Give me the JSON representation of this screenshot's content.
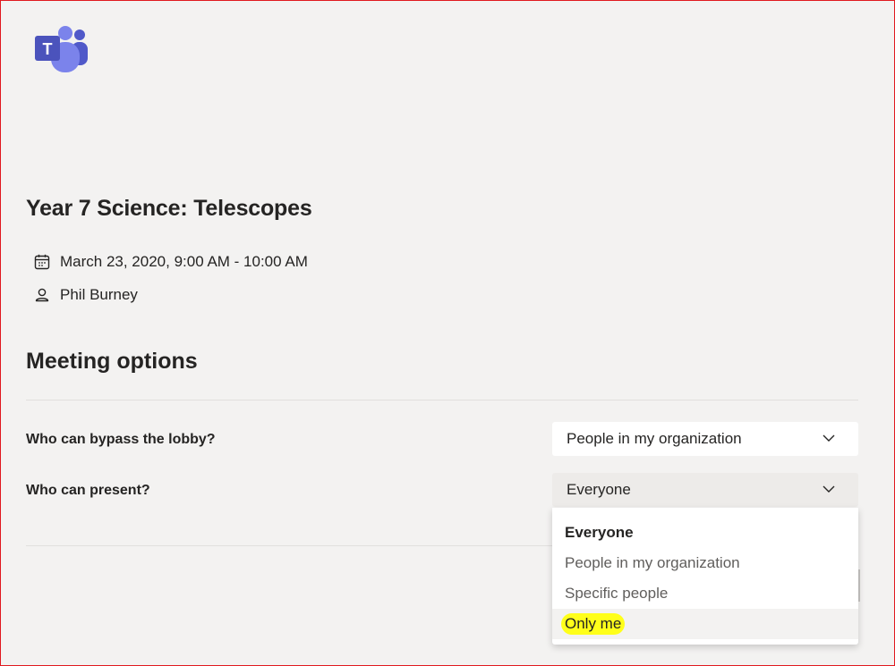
{
  "app": {
    "logo": "microsoft-teams-logo",
    "accent": "#5b5fc7"
  },
  "meeting": {
    "title": "Year 7 Science: Telescopes",
    "datetime": "March 23, 2020, 9:00 AM - 10:00 AM",
    "organizer": "Phil Burney",
    "datetime_icon": "calendar-icon",
    "organizer_icon": "person-icon"
  },
  "options": {
    "heading": "Meeting options",
    "lobby": {
      "label": "Who can bypass the lobby?",
      "value": "People in my organization"
    },
    "present": {
      "label": "Who can present?",
      "value": "Everyone",
      "dropdown_open": true,
      "items": [
        {
          "label": "Everyone",
          "selected": true
        },
        {
          "label": "People in my organization",
          "selected": false
        },
        {
          "label": "Specific people",
          "selected": false
        },
        {
          "label": "Only me",
          "selected": false,
          "hovered": true,
          "highlighted": true
        }
      ]
    }
  },
  "colors": {
    "background": "#f3f2f1",
    "highlight": "#ffff1a",
    "frame": "#e0191f"
  }
}
